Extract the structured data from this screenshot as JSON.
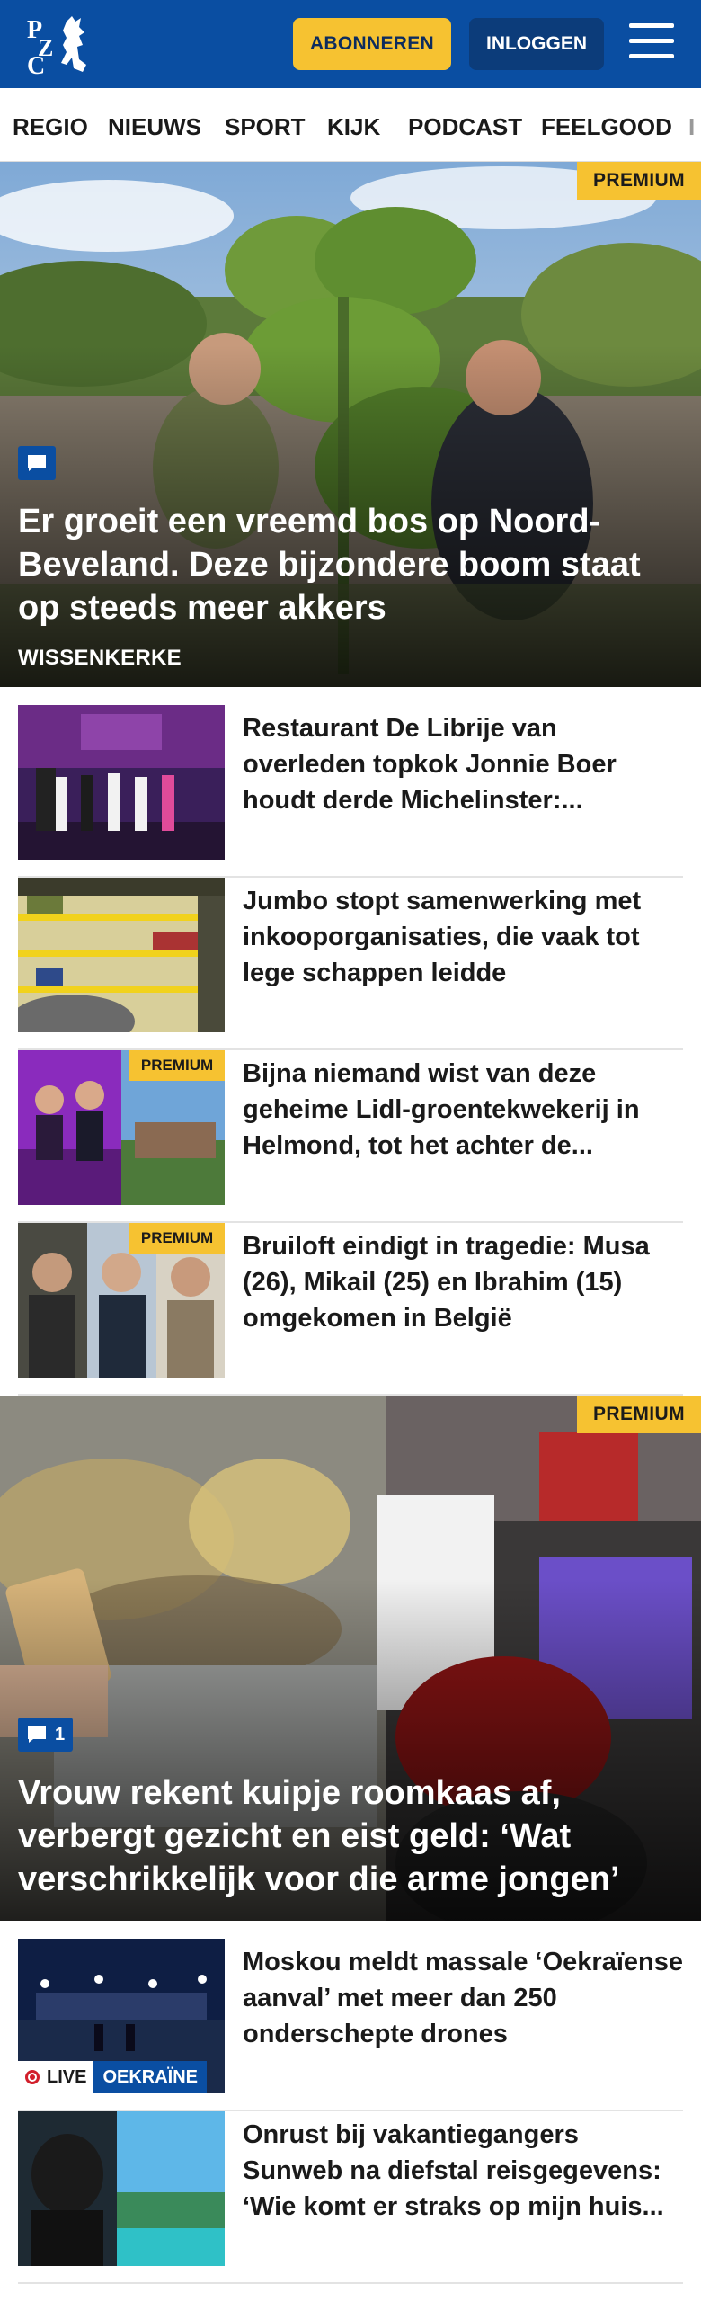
{
  "header": {
    "logo_text": "PZC",
    "subscribe_label": "ABONNEREN",
    "login_label": "INLOGGEN",
    "menu_icon": "hamburger-menu-icon"
  },
  "nav": {
    "items": [
      "REGIO",
      "NIEUWS",
      "SPORT",
      "KIJK",
      "PODCAST",
      "FEELGOOD",
      "I"
    ]
  },
  "hero1": {
    "badge": "PREMIUM",
    "comment_icon": "comment-icon",
    "title": "Er groeit een vreemd bos op Noord-Beveland. Deze bijzondere boom staat op steeds meer akkers",
    "kicker": "WISSENKERKE"
  },
  "articles": [
    {
      "title": "Restaurant De Librije van overleden topkok Jonnie Boer houdt derde Michelinster:...",
      "premium": ""
    },
    {
      "title": "Jumbo stopt samenwerking met inkooporganisaties, die vaak tot lege schappen leidde",
      "premium": ""
    },
    {
      "title": "Bijna niemand wist van deze geheime Lidl-groentekwekerij in Helmond, tot het achter de...",
      "premium": "PREMIUM"
    },
    {
      "title": "Bruiloft eindigt in tragedie: Musa (26), Mikail (25) en Ibrahim (15) omgekomen in België",
      "premium": "PREMIUM"
    }
  ],
  "hero2": {
    "badge": "PREMIUM",
    "comment_icon": "comment-icon",
    "comment_count": "1",
    "title": "Vrouw rekent kuipje roomkaas af, verbergt gezicht en eist geld: ‘Wat verschrikkelijk voor die arme jongen’"
  },
  "articles2": [
    {
      "title": "Moskou meldt massale ‘Oekraïense aanval’ met meer dan 250 onderschepte drones",
      "live_label": "LIVE",
      "tag": "OEKRAÏNE"
    },
    {
      "title": "Onrust bij vakantiegangers Sunweb na diefstal reisgegevens: ‘Wie komt er straks op mijn huis..."
    }
  ],
  "colors": {
    "brand_blue": "#0a4ea2",
    "premium_yellow": "#f6c231",
    "live_red": "#d21f2b"
  }
}
